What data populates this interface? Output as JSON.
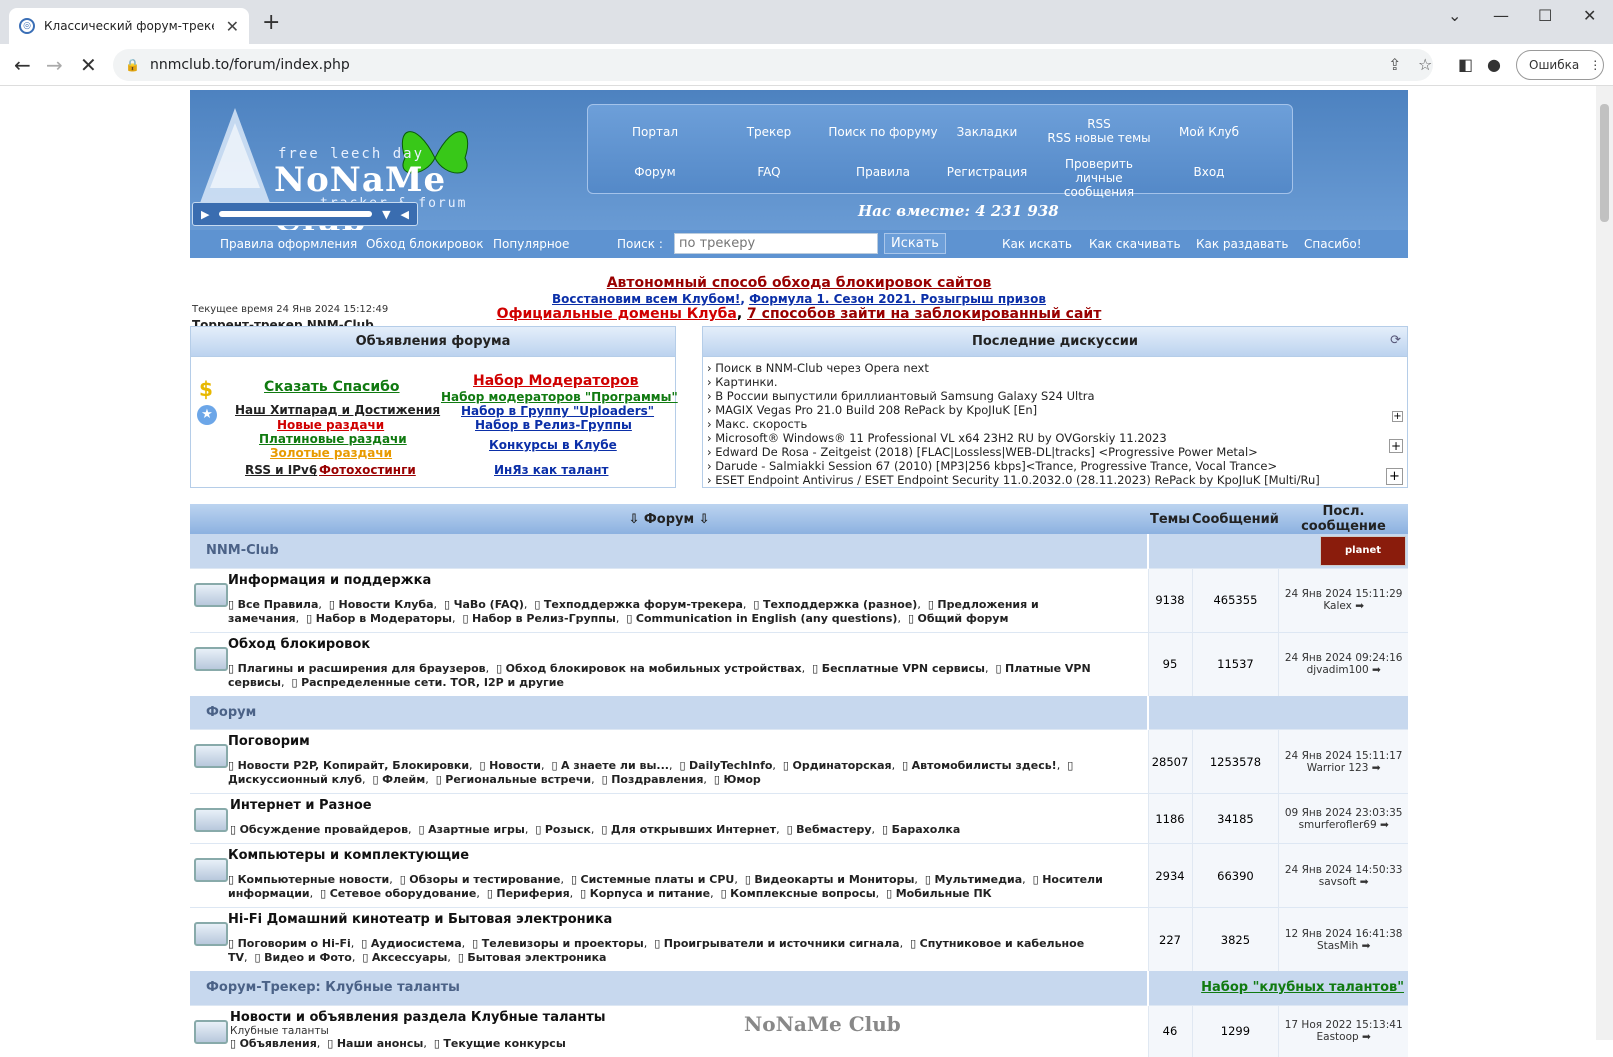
{
  "browser": {
    "tab_title": "Классический форум-трекер :: ",
    "url": "nnmclub.to/forum/index.php",
    "profile_error": "Ошибка"
  },
  "header": {
    "logo_top": "free leech day",
    "logo_main": "NoNaMe Club",
    "logo_sub": "tracker & forum",
    "menu": [
      {
        "label": "Портал"
      },
      {
        "label": "Трекер"
      },
      {
        "label": "Поиск по форуму"
      },
      {
        "label": "Закладки"
      },
      {
        "label": "RSS\nRSS новые темы"
      },
      {
        "label": "Мой Клуб"
      },
      {
        "label": "Форум"
      },
      {
        "label": "FAQ"
      },
      {
        "label": "Правила"
      },
      {
        "label": "Регистрация"
      },
      {
        "label": "Проверить личные сообщения"
      },
      {
        "label": "Вход"
      }
    ],
    "together": "Нас вместе: 4 231 938"
  },
  "subnav": {
    "left": [
      "Правила оформления",
      "Обход блокировок",
      "Популярное"
    ],
    "search_label": "Поиск :",
    "search_placeholder": "по трекеру",
    "search_button": "Искать",
    "right": [
      "Как искать",
      "Как скачивать",
      "Как раздавать",
      "Спасибо!"
    ]
  },
  "meta": {
    "time": "Текущее время 24 Янв 2024 15:12:49",
    "tracker": "Торрент-трекер NNM-Club"
  },
  "banners": {
    "line1": "Автономный способ обхода блокировок сайтов",
    "line2a": "Восстановим всем Клубом!",
    "line2b": "Формула 1. Сезон 2021. Розыгрыш призов",
    "line3a": "Официальные домены Клуба",
    "line3b": "7 способов зайти на заблокированный сайт"
  },
  "announcements": {
    "title": "Объявления форума",
    "left": [
      "Сказать Спасибо",
      "Наш Хитпарад и Достижения",
      "Новые раздачи",
      "Платиновые раздачи",
      "Золотые раздачи",
      "RSS и IPv6",
      "Фотохостинги"
    ],
    "right": [
      "Набор Модераторов",
      "Набор модераторов \"Программы\"",
      "Набор в Группу \"Uploaders\"",
      "Набор в Релиз-Группы",
      "Конкурсы в Клубе",
      "ИнЯз как талант"
    ]
  },
  "discussions": {
    "title": "Последние дискуссии",
    "items": [
      "Поиск в NNM-Club через Opera next",
      "Картинки.",
      "В России выпустили бриллиантовый Samsung Galaxy S24 Ultra",
      "MAGIX Vegas Pro 21.0 Build 208 RePack by KpoJIuK [En]",
      "Макс. скорость",
      "Microsoft® Windows® 11 Professional VL x64 23H2 RU by OVGorskiy 11.2023",
      "Edward De Rosa - Zeitgeist (2018) [FLAC|Lossless|WEB-DL|tracks] <Progressive Power Metal>",
      "Darude - Salmiakki Session 67 (2010) [MP3|256 kbps]<Trance, Progressive Trance, Vocal Trance>",
      "ESET Endpoint Antivirus / ESET Endpoint Security 11.0.2032.0 (28.11.2023) RePack by KpoJIuK [Multi/Ru]"
    ]
  },
  "forum_table": {
    "col_forum": "Форум",
    "col_topics": "Темы",
    "col_posts": "Сообщений",
    "col_last": "Посл. сообщение",
    "cat_link": "Набор \"клубных талантов\"",
    "cat_image": "planet"
  },
  "categories": [
    {
      "name": "NNM-Club",
      "forums": [
        {
          "name": "Информация и поддержка",
          "subs": [
            "Все Правила",
            "Новости Клуба",
            "ЧаВо (FAQ)",
            "Техподдержка форум-трекера",
            "Техподдержка (разное)",
            "Предложения и замечания",
            "Набор в Модераторы",
            "Набор в Релиз-Группы",
            "Communication in English (any questions)",
            "Общий форум"
          ],
          "topics": "9138",
          "posts": "465355",
          "last_date": "24 Янв 2024 15:11:29",
          "last_user": "Kalex"
        },
        {
          "name": "Обход блокировок",
          "subs": [
            "Плагины и расширения для браузеров",
            "Обход блокировок на мобильных устройствах",
            "Бесплатные VPN сервисы",
            "Платные VPN сервисы",
            "Распределенные сети. TOR, I2P и другие"
          ],
          "topics": "95",
          "posts": "11537",
          "last_date": "24 Янв 2024 09:24:16",
          "last_user": "djvadim100"
        }
      ]
    },
    {
      "name": "Форум",
      "forums": [
        {
          "name": "Поговорим",
          "subs": [
            "Новости P2P, Копирайт, Блокировки",
            "Новости",
            "А знаете ли вы...",
            "DailyTechInfo",
            "Ординаторская",
            "Автомобилисты здесь!",
            "Дискуссионный клуб",
            "Флейм",
            "Региональные встречи",
            "Поздравления",
            "Юмор"
          ],
          "topics": "28507",
          "posts": "1253578",
          "last_date": "24 Янв 2024 15:11:17",
          "last_user": "Warrior 123"
        },
        {
          "name": "Интернет и Разное",
          "subs": [
            "Обсуждение провайдеров",
            "Азартные игры",
            "Розыск",
            "Для открывших Интернет",
            "Вебмастеру",
            "Барахолка"
          ],
          "topics": "1186",
          "posts": "34185",
          "last_date": "09 Янв 2024 23:03:35",
          "last_user": "smurferofler69"
        },
        {
          "name": "Компьютеры и комплектующие",
          "subs": [
            "Компьютерные новости",
            "Обзоры и тестирование",
            "Системные платы и CPU",
            "Видеокарты и Мониторы",
            "Мультимедиа",
            "Носители информации",
            "Сетевое оборудование",
            "Периферия",
            "Корпуса и питание",
            "Комплексные вопросы",
            "Мобильные ПК"
          ],
          "topics": "2934",
          "posts": "66390",
          "last_date": "24 Янв 2024 14:50:33",
          "last_user": "savsoft"
        },
        {
          "name": "Hi-Fi Домашний кинотеатр и Бытовая электроника",
          "subs": [
            "Поговорим о Hi-Fi",
            "Аудиосистема",
            "Телевизоры и проекторы",
            "Проигрыватели и источники сигнала",
            "Спутниковое и кабельное TV",
            "Видео и Фото",
            "Аксессуары",
            "Бытовая электроника"
          ],
          "topics": "227",
          "posts": "3825",
          "last_date": "12 Янв 2024 16:41:38",
          "last_user": "StasMih"
        }
      ]
    },
    {
      "name": "Форум-Трекер: Клубные таланты",
      "forums": [
        {
          "name": "Новости и объявления раздела Клубные таланты",
          "desc": "Клубные таланты",
          "subs": [
            "Объявления",
            "Наши анонсы",
            "Текущие конкурсы"
          ],
          "topics": "46",
          "posts": "1299",
          "last_date": "17 Ноя 2022 15:13:41",
          "last_user": "Eastoop"
        }
      ]
    }
  ],
  "watermark": "NoNaMe Club",
  "colors": {
    "header_blue": "#4d82c0",
    "dark_red": "#990000",
    "link_blue": "#0b2fa8",
    "green": "#107a10",
    "red": "#d00000",
    "orange": "#e89b00"
  }
}
